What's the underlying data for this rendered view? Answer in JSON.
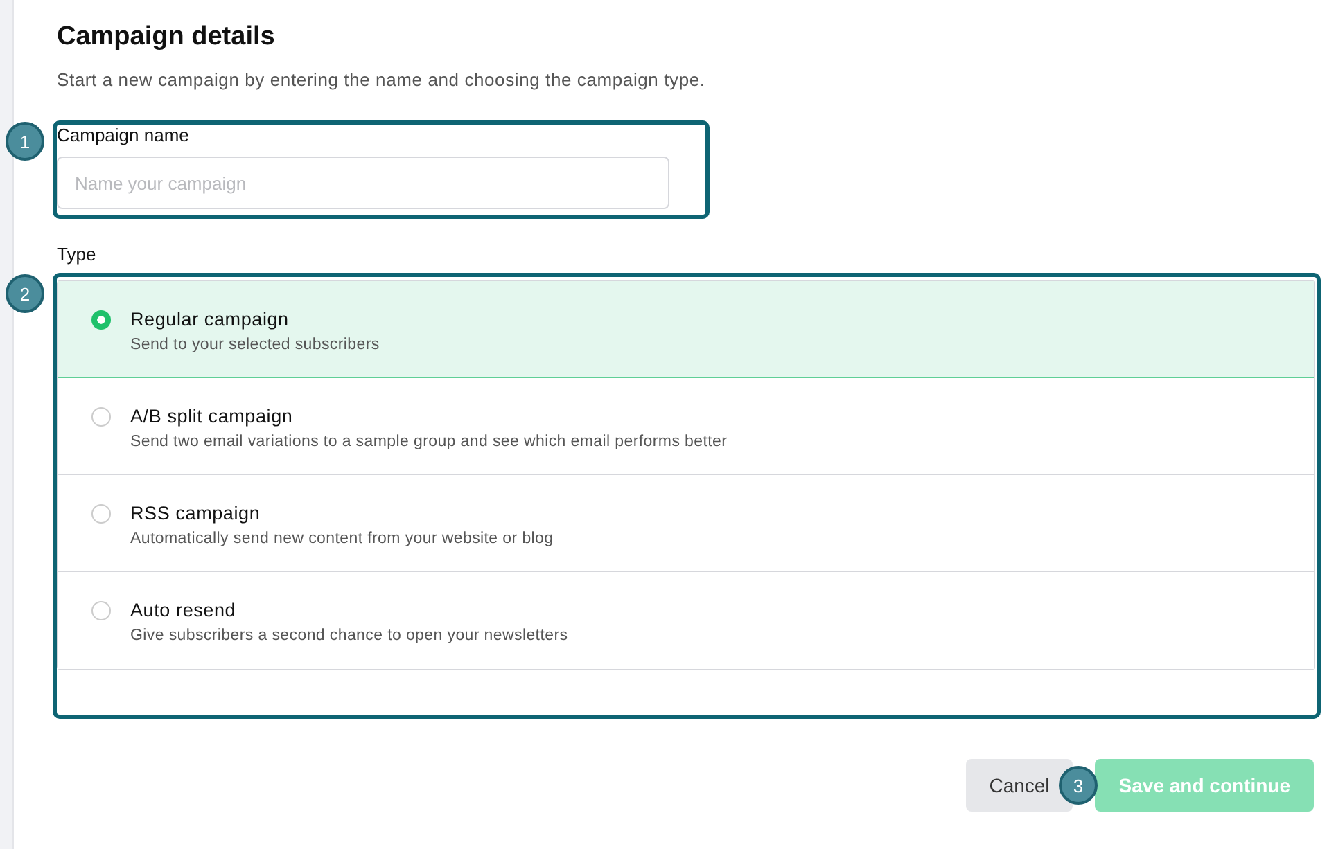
{
  "header": {
    "title": "Campaign details",
    "subtitle": "Start a new campaign by entering the name and choosing the campaign type."
  },
  "name_field": {
    "label": "Campaign name",
    "placeholder": "Name your campaign",
    "callout": "1"
  },
  "type_group": {
    "label": "Type",
    "callout": "2",
    "options": [
      {
        "title": "Regular campaign",
        "description": "Send to your selected subscribers",
        "selected": true
      },
      {
        "title": "A/B split campaign",
        "description": "Send two email variations to a sample group and see which email performs better",
        "selected": false
      },
      {
        "title": "RSS campaign",
        "description": "Automatically send new content from your website or blog",
        "selected": false
      },
      {
        "title": "Auto resend",
        "description": "Give subscribers a second chance to open your newsletters",
        "selected": false
      }
    ]
  },
  "actions": {
    "cancel": "Cancel",
    "save": {
      "label": "Save and continue",
      "disabled": true
    },
    "callout": "3"
  }
}
